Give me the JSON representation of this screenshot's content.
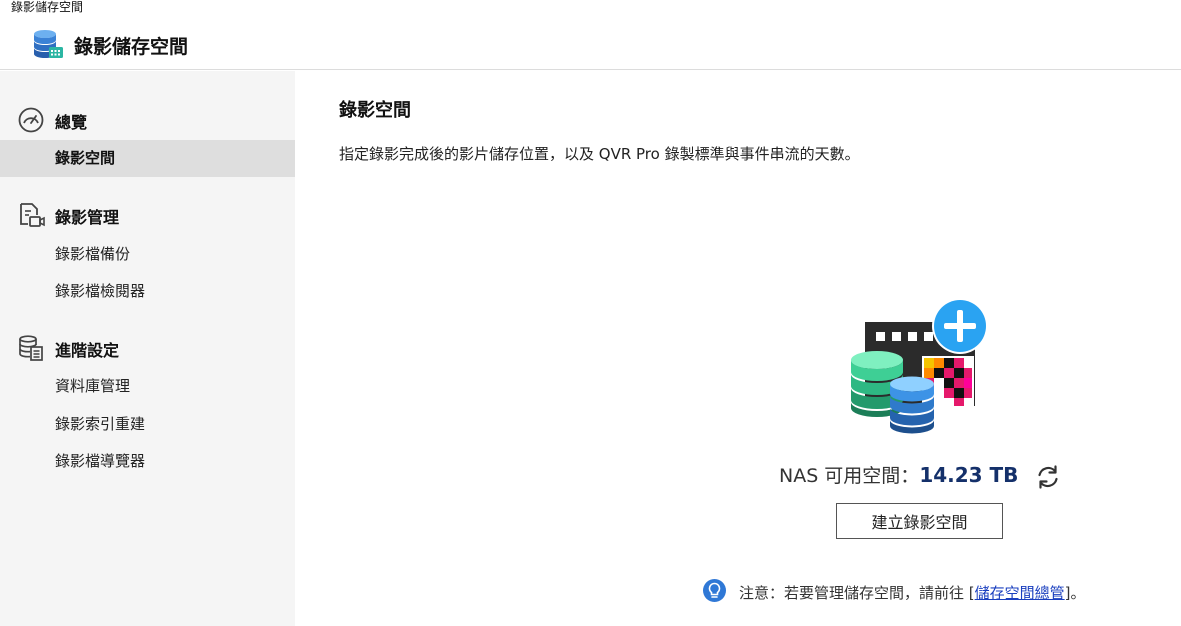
{
  "window": {
    "title": "錄影儲存空間"
  },
  "header": {
    "title": "錄影儲存空間"
  },
  "sidebar": {
    "sections": [
      {
        "label": "總覽",
        "icon": "dashboard-gauge-icon",
        "items": [
          {
            "label": "錄影空間",
            "active": true
          }
        ]
      },
      {
        "label": "錄影管理",
        "icon": "recording-file-icon",
        "items": [
          {
            "label": "錄影檔備份"
          },
          {
            "label": "錄影檔檢閱器"
          }
        ]
      },
      {
        "label": "進階設定",
        "icon": "database-settings-icon",
        "items": [
          {
            "label": "資料庫管理"
          },
          {
            "label": "錄影索引重建"
          },
          {
            "label": "錄影檔導覽器"
          }
        ]
      }
    ]
  },
  "main": {
    "title": "錄影空間",
    "description": "指定錄影完成後的影片儲存位置，以及 QVR Pro 錄製標準與事件串流的天數。",
    "nas_space": {
      "label": "NAS 可用空間：",
      "value": "14.23 TB"
    },
    "create_button": "建立錄影空間",
    "note": {
      "prefix": "注意：若要管理儲存空間，請前往 [",
      "link": "儲存空間總管",
      "suffix": "]。"
    }
  },
  "colors": {
    "accent": "#14306a",
    "link": "#1a3fbf",
    "plus": "#2aa3f2",
    "sidebar_bg": "#f5f5f5"
  }
}
